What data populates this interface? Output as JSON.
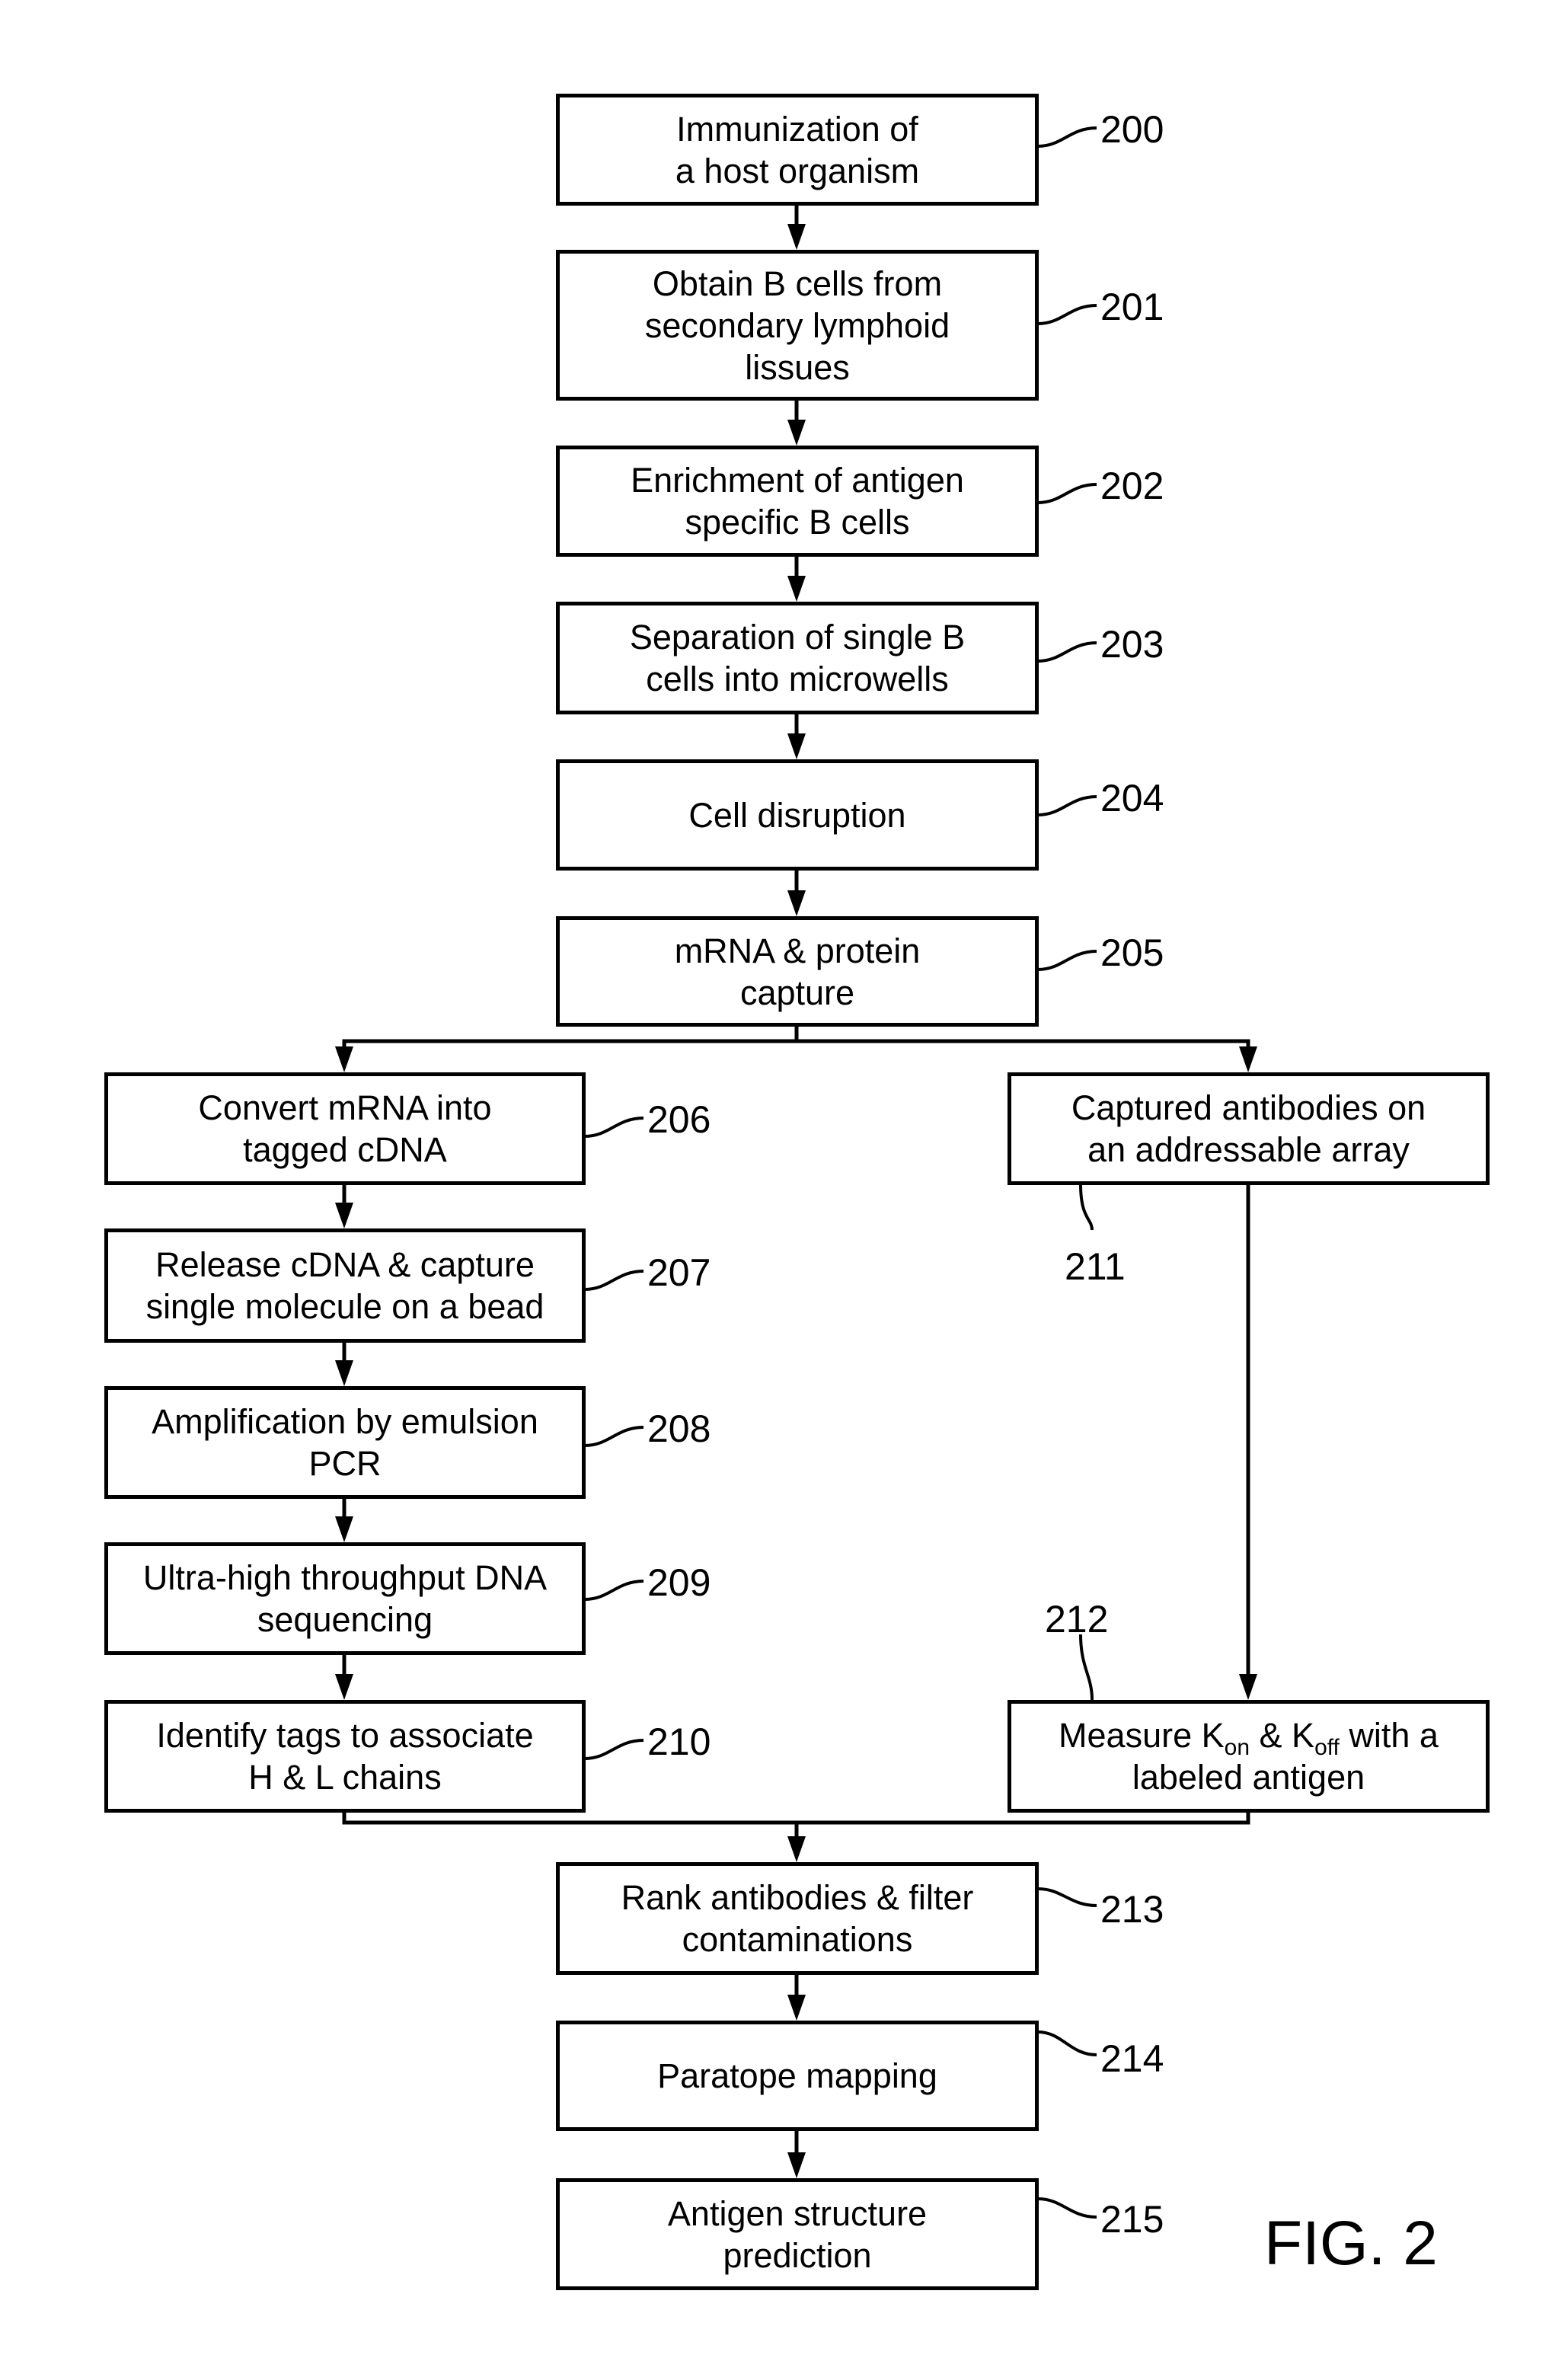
{
  "figure_label": "FIG. 2",
  "steps": {
    "s200": {
      "ref": "200",
      "text": "Immunization of\na host organism"
    },
    "s201": {
      "ref": "201",
      "text": "Obtain B cells from\nsecondary lymphoid\nlissues"
    },
    "s202": {
      "ref": "202",
      "text": "Enrichment of antigen\nspecific B cells"
    },
    "s203": {
      "ref": "203",
      "text": "Separation of single B\ncells into microwells"
    },
    "s204": {
      "ref": "204",
      "text": "Cell disruption"
    },
    "s205": {
      "ref": "205",
      "text": "mRNA & protein\ncapture"
    },
    "s206": {
      "ref": "206",
      "text": "Convert mRNA into\ntagged cDNA"
    },
    "s207": {
      "ref": "207",
      "text": "Release cDNA & capture\nsingle molecule on a bead"
    },
    "s208": {
      "ref": "208",
      "text": "Amplification by emulsion\nPCR"
    },
    "s209": {
      "ref": "209",
      "text": "Ultra-high throughput DNA\nsequencing"
    },
    "s210": {
      "ref": "210",
      "text": "Identify tags to associate\nH & L chains"
    },
    "s211": {
      "ref": "211",
      "text": "Captured antibodies on\nan addressable array"
    },
    "s212": {
      "ref": "212",
      "line1_pre": "Measure K",
      "sub_on": "on",
      "mid": " & K",
      "sub_off": "off",
      "line1_post": " with a",
      "line2": "labeled antigen"
    },
    "s213": {
      "ref": "213",
      "text": "Rank antibodies & filter\ncontaminations"
    },
    "s214": {
      "ref": "214",
      "text": "Paratope mapping"
    },
    "s215": {
      "ref": "215",
      "text": "Antigen structure\nprediction"
    }
  }
}
